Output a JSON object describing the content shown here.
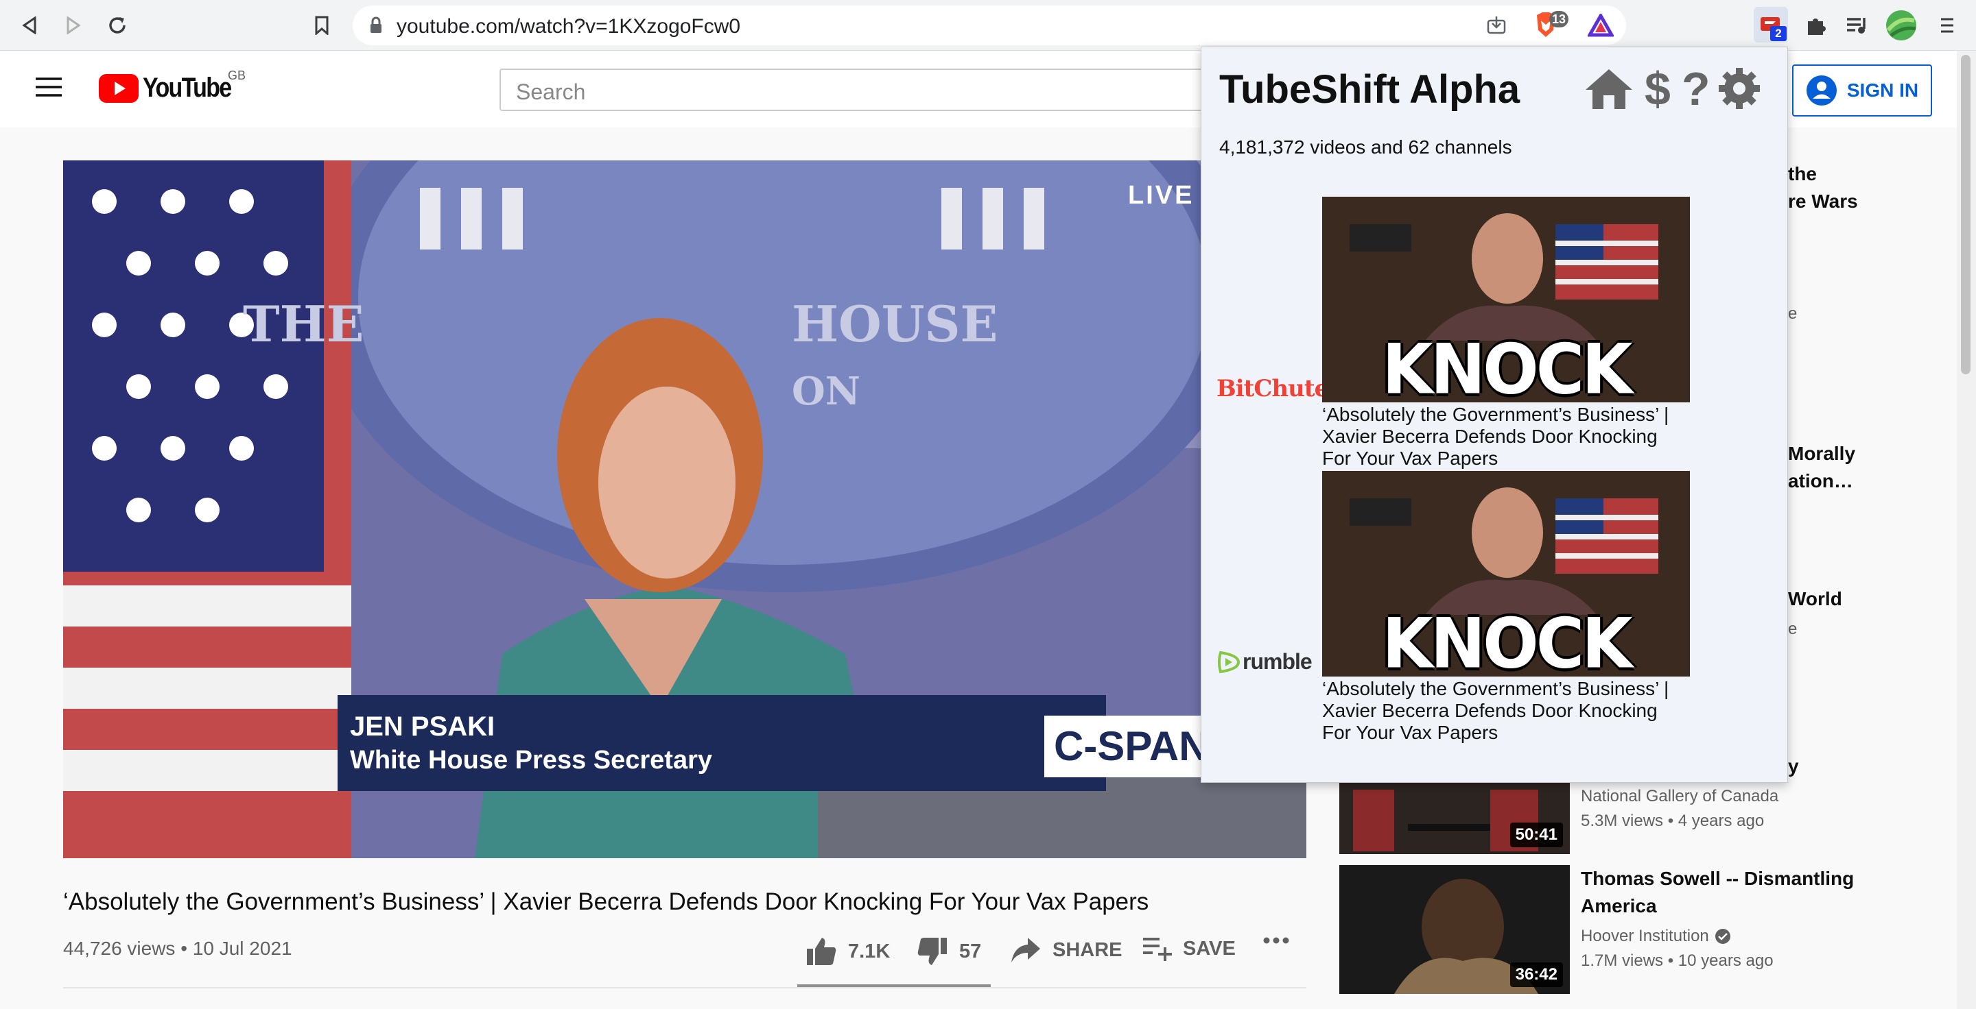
{
  "browser": {
    "url": "youtube.com/watch?v=1KXzogoFcw0",
    "brave_badge": "13",
    "tubeshift_badge": "2"
  },
  "header": {
    "logo_text": "YouTube",
    "region": "GB",
    "search_placeholder": "Search",
    "sign_in": "SIGN IN"
  },
  "video": {
    "live_badge": "LIVE",
    "banner_name": "JEN PSAKI",
    "banner_role": "White House Press Secretary",
    "seal_text_1": "THE",
    "seal_text_2": "HOUSE",
    "seal_text_3": "ON",
    "network": "C-SPAN",
    "title": "‘Absolutely the Government’s Business’ | Xavier Becerra Defends Door Knocking For Your Vax Papers",
    "views": "44,726 views",
    "date": "10 Jul 2021",
    "likes": "7.1K",
    "dislikes": "57",
    "share": "SHARE",
    "save": "SAVE"
  },
  "popup": {
    "title": "TubeShift Alpha",
    "count": "4,181,372 videos and 62 channels",
    "results": [
      {
        "platform": "BitChute",
        "thumb_text": "KNOCK KNOCK",
        "title": "‘Absolutely the Government’s Business’ | Xavier Becerra Defends Door Knocking For Your Vax Papers"
      },
      {
        "platform": "rumble",
        "thumb_text": "KNOCK KNOCK",
        "title": "‘Absolutely the Government’s Business’ | Xavier Becerra Defends Door Knocking For Your Vax Papers"
      }
    ]
  },
  "related": {
    "fragments": [
      "the",
      "re Wars",
      "e",
      "Morally",
      "ation…",
      "World",
      "e",
      "y"
    ],
    "items": [
      {
        "title": "",
        "channel": "National Gallery of Canada",
        "stats": "5.3M views • 4 years ago",
        "duration": "50:41"
      },
      {
        "title": "Thomas Sowell -- Dismantling America",
        "channel": "Hoover Institution",
        "stats": "1.7M views • 10 years ago",
        "duration": "36:42"
      }
    ]
  },
  "colors": {
    "yt_red": "#ff0000",
    "link_blue": "#065fd4",
    "popup_bg": "#f0f4fa",
    "bitchute_red": "#ef4136",
    "rumble_green": "#85c742"
  }
}
